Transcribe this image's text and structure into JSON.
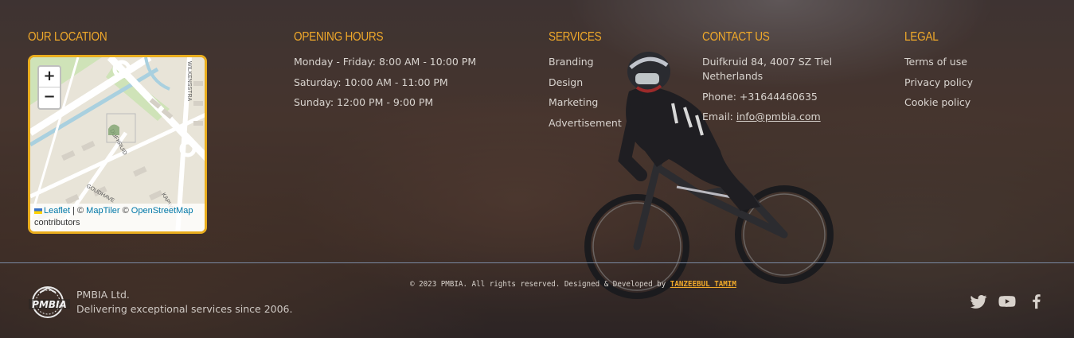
{
  "location": {
    "heading": "OUR LOCATION",
    "map": {
      "zoom_in": "+",
      "zoom_out": "−",
      "street_1": "WILKENSSTRA",
      "street_2": "DUFKRUID",
      "street_3": "GOUDHAVE",
      "street_4": "KAPWI",
      "attribution_leaflet": "Leaflet",
      "attribution_sep": " | © ",
      "attribution_maptiler": "MapTiler",
      "attribution_copy": " © ",
      "attribution_osm": "OpenStreetMap",
      "attribution_contrib": "contributors"
    }
  },
  "hours": {
    "heading": "OPENING HOURS",
    "lines": [
      "Monday - Friday: 8:00 AM - 10:00 PM",
      "Saturday: 10:00 AM - 11:00 PM",
      "Sunday: 12:00 PM - 9:00 PM"
    ]
  },
  "services": {
    "heading": "SERVICES",
    "items": [
      "Branding",
      "Design",
      "Marketing",
      "Advertisement"
    ]
  },
  "contact": {
    "heading": "CONTACT US",
    "address_1": "Duifkruid 84, 4007 SZ Tiel",
    "address_2": "Netherlands",
    "phone": "Phone: +31644460635",
    "email_label": "Email: ",
    "email": "info@pmbia.com"
  },
  "legal": {
    "heading": "LEGAL",
    "items": [
      "Terms of use",
      "Privacy policy",
      "Cookie policy"
    ]
  },
  "footer": {
    "copyright": "© 2023 PMBIA. All rights reserved. Designed & Developed by ",
    "developer": "TANZEEBUL TAMIM",
    "company": "PMBIA Ltd.",
    "tagline": "Delivering exceptional services since 2006.",
    "logo_text": "PMBIA",
    "social": [
      "twitter-icon",
      "youtube-icon",
      "facebook-icon"
    ]
  },
  "colors": {
    "accent": "#f0a92a",
    "text": "#d9d4cf",
    "divider": "#7a8aa3"
  }
}
